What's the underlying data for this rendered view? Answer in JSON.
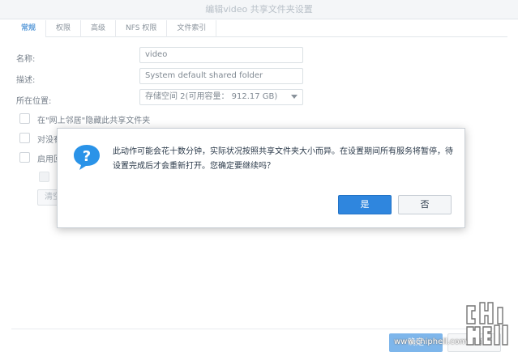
{
  "window": {
    "title": "编辑video 共享文件夹设置"
  },
  "tabs": [
    {
      "label": "常规",
      "active": true
    },
    {
      "label": "权限"
    },
    {
      "label": "高级"
    },
    {
      "label": "NFS 权限"
    },
    {
      "label": "文件索引"
    }
  ],
  "form": {
    "name_label": "名称:",
    "name_value": "video",
    "desc_label": "描述:",
    "desc_value": "System default shared folder",
    "location_label": "所在位置:",
    "location_value": "存储空间 2(可用容量： 912.17 GB)",
    "hide_network_label": "在\"网上邻居\"隐藏此共享文件夹",
    "row2_label_partial": "对没有",
    "row3_label_partial": "启用回",
    "cleanup_button_partial": "清空"
  },
  "footer": {
    "ok_label": "确定",
    "cancel_label": "取消"
  },
  "dialog": {
    "message": "此动作可能会花十数分钟，实际状况按照共享文件夹大小而异。在设置期间所有服务将暂停，待设置完成后才会重新打开。您确定要继续吗？",
    "yes_label": "是",
    "no_label": "否"
  },
  "watermark": {
    "url": "www.chiphell.com"
  },
  "colors": {
    "accent": "#2f86de",
    "tab_active": "#0d6cc7",
    "icon_blue": "#2a93e8"
  }
}
